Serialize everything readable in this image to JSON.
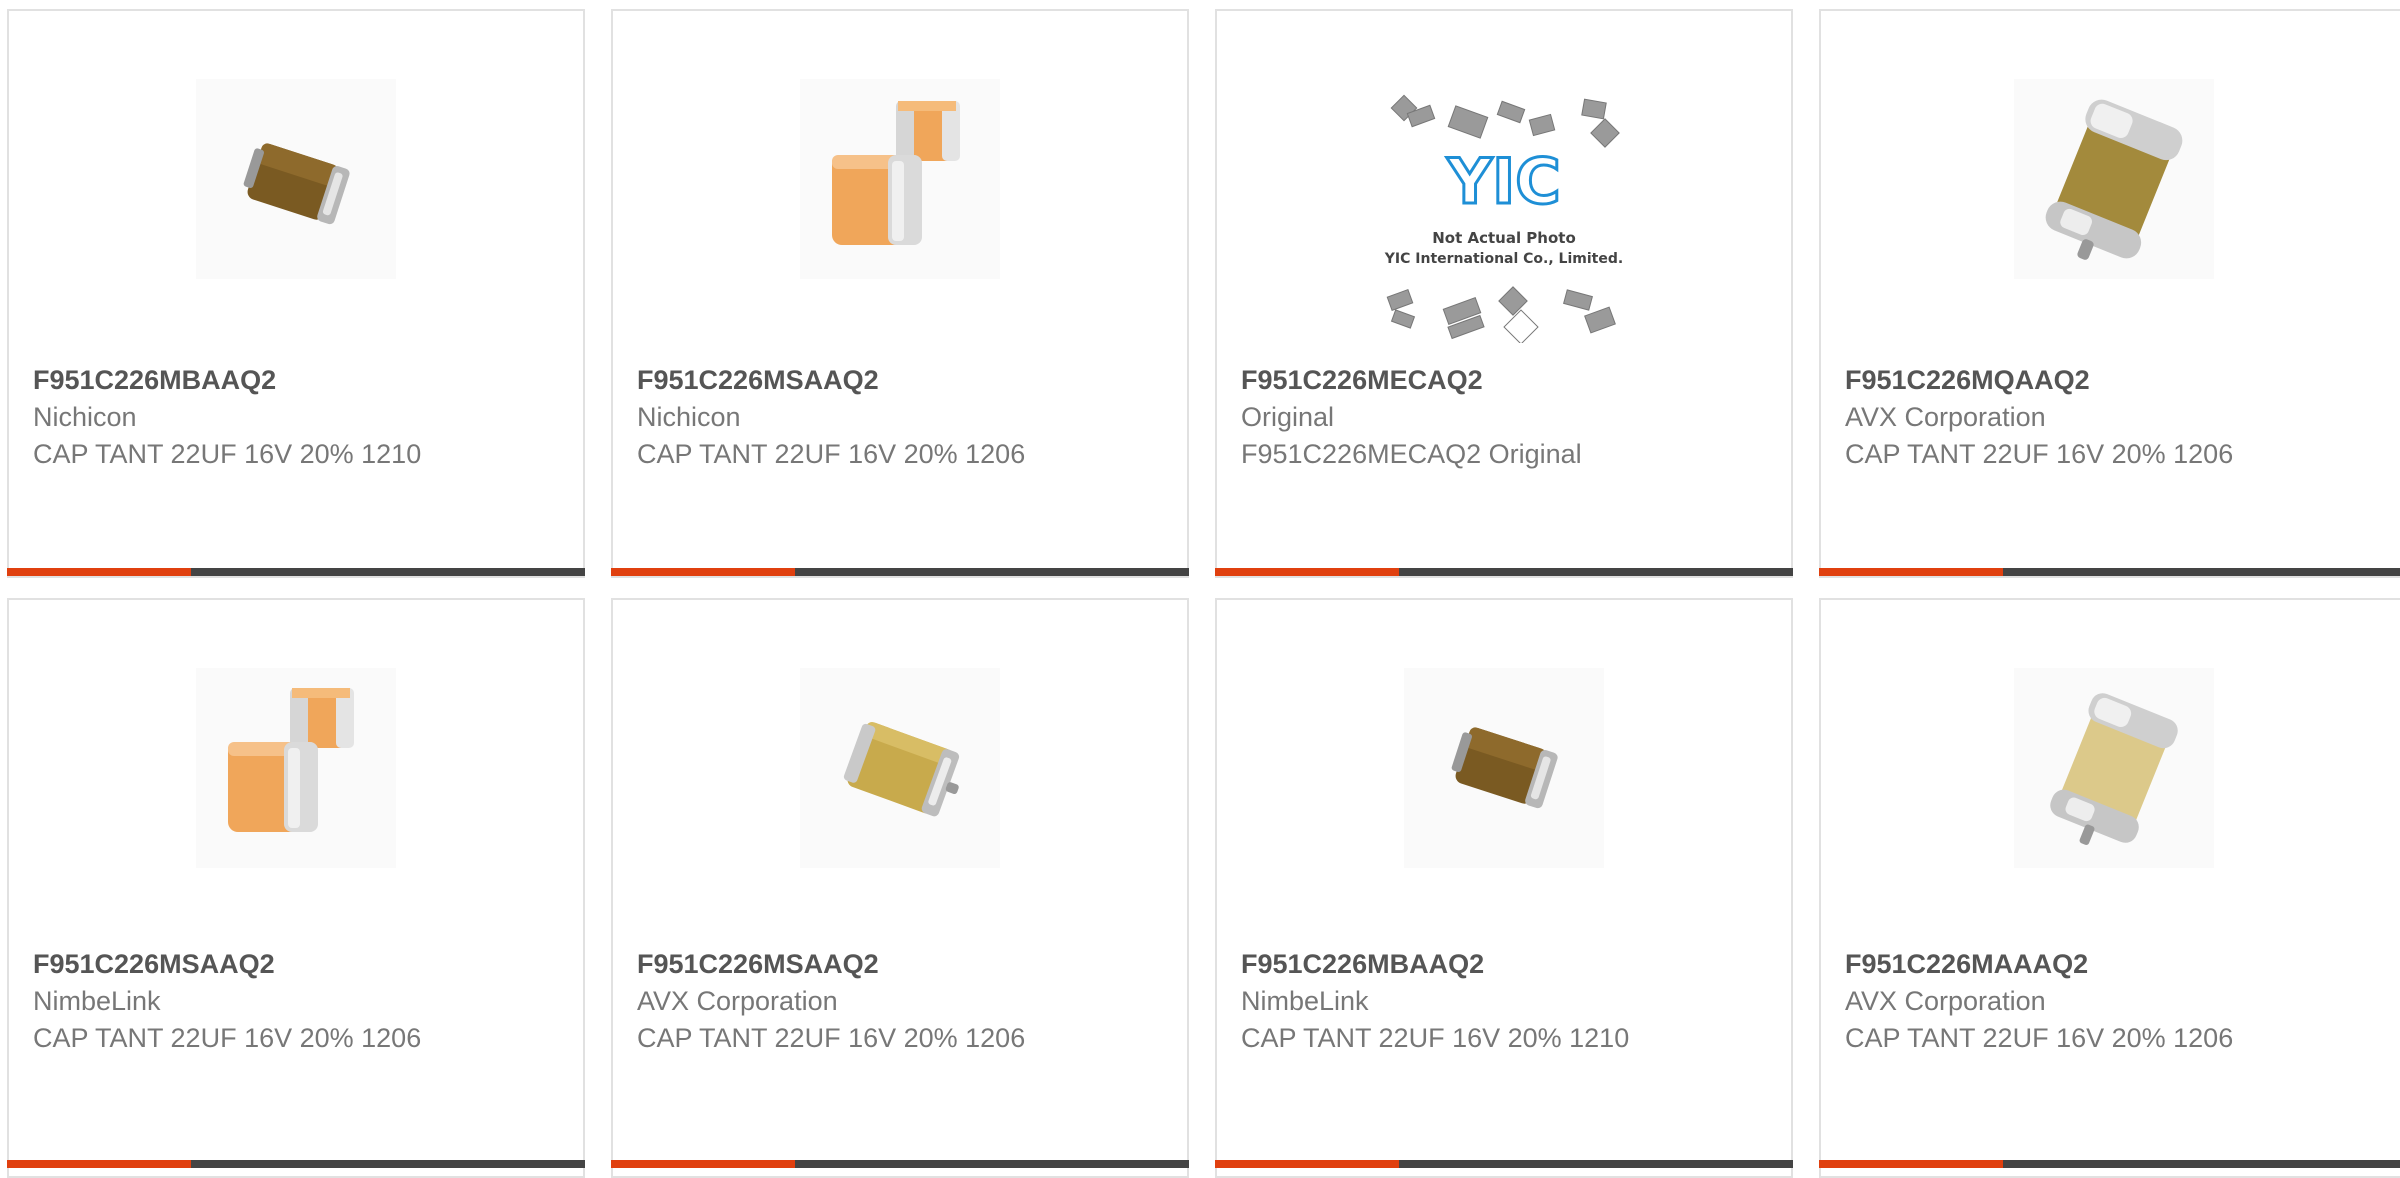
{
  "products": [
    {
      "part_number": "F951C226MBAAQ2",
      "manufacturer": "Nichicon",
      "description": "CAP TANT 22UF 16V 20% 1210",
      "image": "tantalum-brown-chip"
    },
    {
      "part_number": "F951C226MSAAQ2",
      "manufacturer": "Nichicon",
      "description": "CAP TANT 22UF 16V 20% 1206",
      "image": "orange-chip-pair"
    },
    {
      "part_number": "F951C226MECAQ2",
      "manufacturer": "Original",
      "description": "F951C226MECAQ2 Original",
      "image": "yic-placeholder",
      "placeholder_logo": "YIC",
      "placeholder_line1": "Not Actual Photo",
      "placeholder_line2": "YIC International Co., Limited."
    },
    {
      "part_number": "F951C226MQAAQ2",
      "manufacturer": "AVX Corporation",
      "description": "CAP TANT 22UF 16V 20% 1206",
      "image": "tantalum-molded-lead"
    },
    {
      "part_number": "F951C226MSAAQ2",
      "manufacturer": "NimbeLink",
      "description": "CAP TANT 22UF 16V 20% 1206",
      "image": "orange-chip-pair"
    },
    {
      "part_number": "F951C226MSAAQ2",
      "manufacturer": "AVX Corporation",
      "description": "CAP TANT 22UF 16V 20% 1206",
      "image": "tantalum-yellow-chip"
    },
    {
      "part_number": "F951C226MBAAQ2",
      "manufacturer": "NimbeLink",
      "description": "CAP TANT 22UF 16V 20% 1210",
      "image": "tantalum-brown-chip"
    },
    {
      "part_number": "F951C226MAAAQ2",
      "manufacturer": "AVX Corporation",
      "description": "CAP TANT 22UF 16V 20% 1206",
      "image": "tantalum-yellow-lead"
    }
  ],
  "colors": {
    "accent": "#e0400f",
    "bar": "#444444",
    "border": "#e1e1e1",
    "title": "#555555",
    "text": "#777777"
  }
}
